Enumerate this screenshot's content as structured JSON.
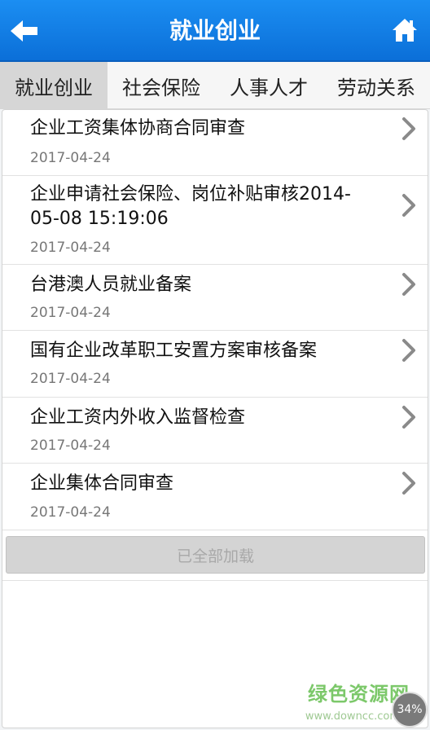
{
  "header": {
    "title": "就业创业",
    "back_icon": "back-arrow-icon",
    "home_icon": "home-icon"
  },
  "tabs": [
    {
      "label": "就业创业",
      "selected": true
    },
    {
      "label": "社会保险",
      "selected": false
    },
    {
      "label": "人事人才",
      "selected": false
    },
    {
      "label": "劳动关系",
      "selected": false
    }
  ],
  "items": [
    {
      "title": "企业工资集体协商合同审查",
      "date": "2017-04-24"
    },
    {
      "title": "企业申请社会保险、岗位补贴审核2014-05-08 15:19:06",
      "date": "2017-04-24"
    },
    {
      "title": "台港澳人员就业备案",
      "date": "2017-04-24"
    },
    {
      "title": "国有企业改革职工安置方案审核备案",
      "date": "2017-04-24"
    },
    {
      "title": "企业工资内外收入监督检查",
      "date": "2017-04-24"
    },
    {
      "title": "企业集体合同审查",
      "date": "2017-04-24"
    }
  ],
  "load_more": {
    "label": "已全部加载"
  },
  "watermark": {
    "text": "绿色资源网",
    "url": "www.downcc.com",
    "badge": "34%"
  },
  "colors": {
    "header": "#0b6fd8",
    "selected_tab": "#d6d6d6",
    "load_more_bg": "#d4d4d4"
  }
}
